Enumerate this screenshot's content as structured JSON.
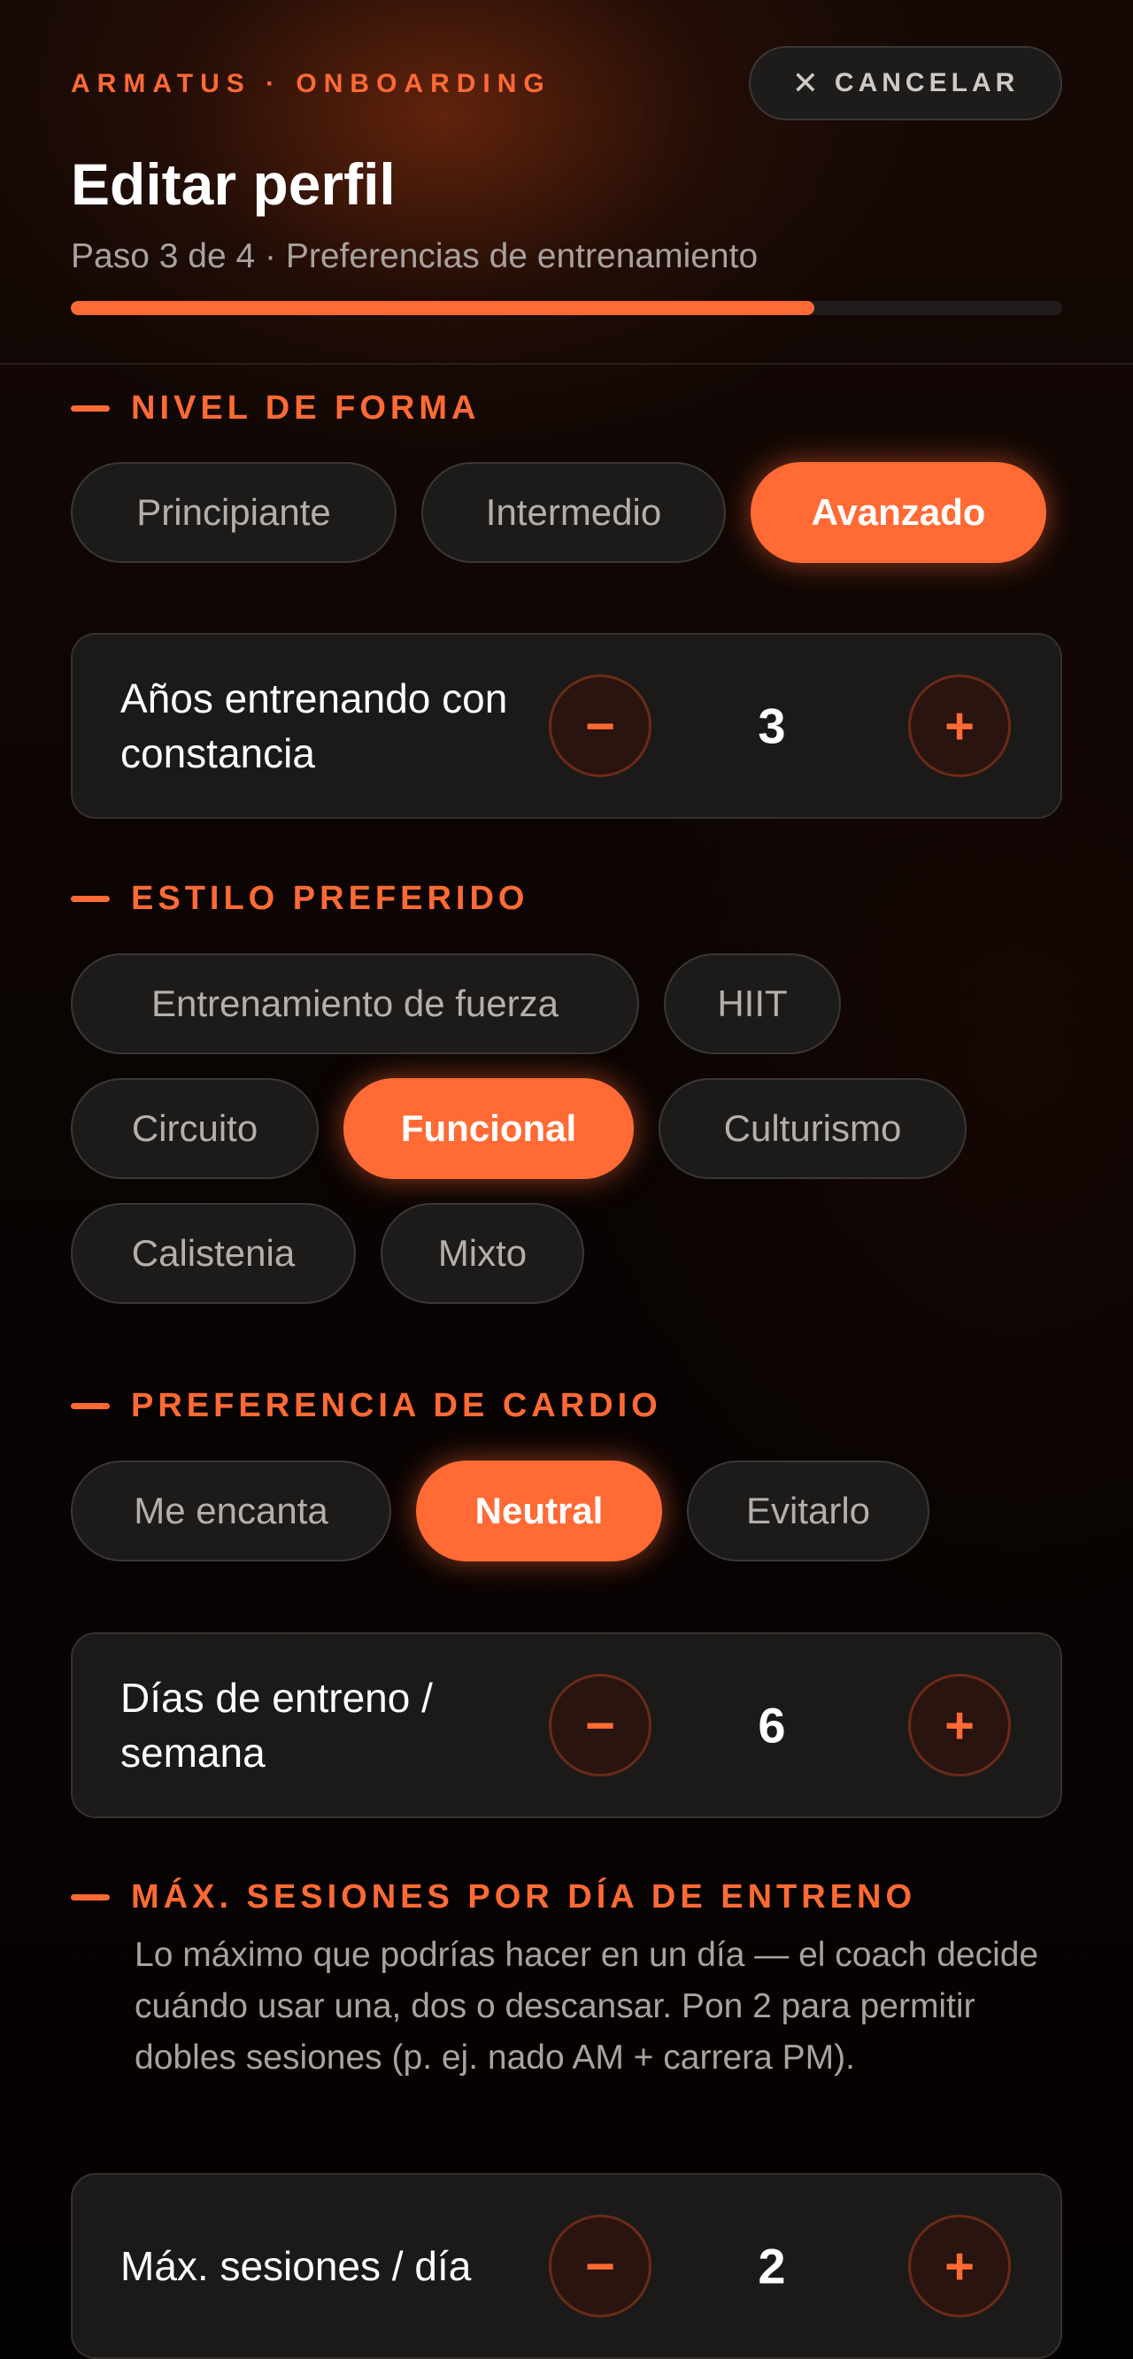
{
  "header": {
    "brand": "ARMATUS · ONBOARDING",
    "cancel_label": "CANCELAR",
    "cancel_icon": "✕",
    "title": "Editar perfil",
    "step_text": "Paso 3 de 4 · Preferencias de entrenamiento",
    "progress_fraction": 0.75
  },
  "fitness": {
    "title": "NIVEL DE FORMA",
    "options": [
      "Principiante",
      "Intermedio",
      "Avanzado"
    ],
    "selected": "Avanzado"
  },
  "years": {
    "label": "Años entrenando con constancia",
    "value": "3",
    "minus": "−",
    "plus": "+"
  },
  "style": {
    "title": "ESTILO PREFERIDO",
    "options": [
      "Entrenamiento de fuerza",
      "HIIT",
      "Circuito",
      "Funcional",
      "Culturismo",
      "Calistenia",
      "Mixto"
    ],
    "selected": "Funcional"
  },
  "cardio": {
    "title": "PREFERENCIA DE CARDIO",
    "options": [
      "Me encanta",
      "Neutral",
      "Evitarlo"
    ],
    "selected": "Neutral"
  },
  "days": {
    "label": "Días de entreno / semana",
    "value": "6",
    "minus": "−",
    "plus": "+"
  },
  "sessions": {
    "title": "MÁX. SESIONES POR DÍA DE ENTRENO",
    "description": "Lo máximo que podrías hacer en un día — el coach decide cuándo usar una, dos o descansar. Pon 2 para permitir dobles sesiones (p. ej. nado AM + carrera PM).",
    "label": "Máx. sesiones / día",
    "value": "2",
    "minus": "−",
    "plus": "+"
  },
  "colors": {
    "accent": "#ff6a35",
    "chip_bg": "#1d1b1a",
    "card_bg": "#1c1a19",
    "muted_text": "#a9a29e"
  }
}
